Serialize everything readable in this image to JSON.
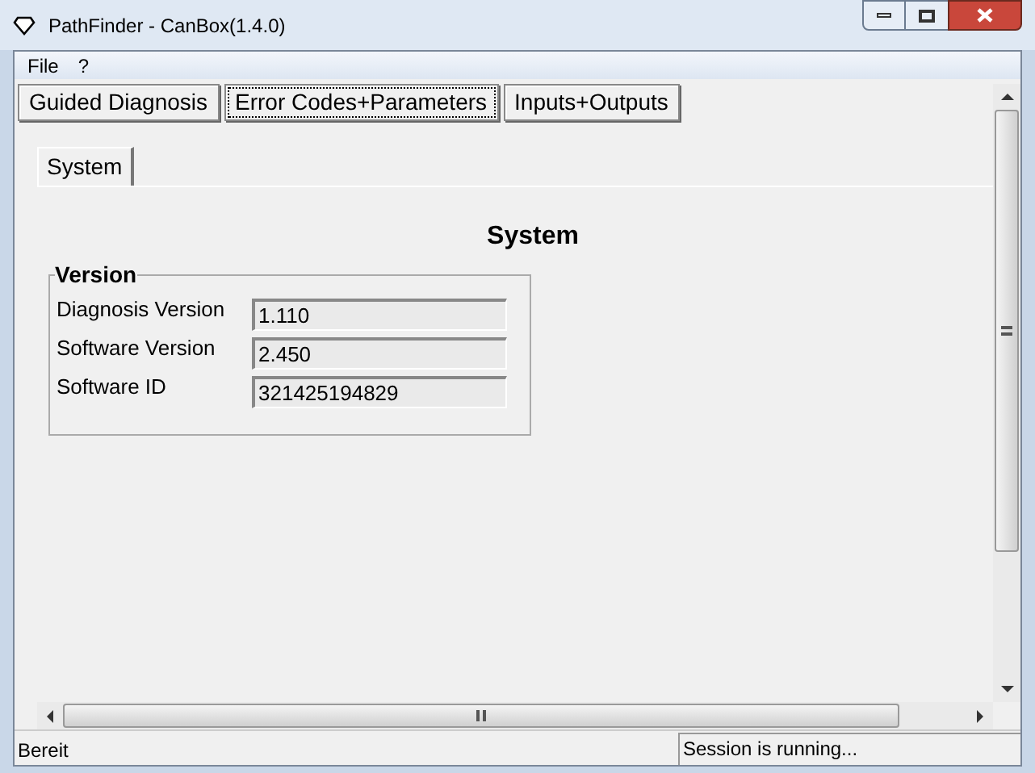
{
  "window": {
    "title": "PathFinder - CanBox(1.4.0)"
  },
  "menu": [
    "File",
    "?"
  ],
  "tabs": [
    {
      "label": "Guided Diagnosis",
      "selected": false
    },
    {
      "label": "Error Codes+Parameters",
      "selected": true
    },
    {
      "label": "Inputs+Outputs",
      "selected": false
    }
  ],
  "subtabs": [
    {
      "label": "System",
      "selected": true
    }
  ],
  "heading": "System",
  "group": {
    "title": "Version",
    "fields": [
      {
        "label": "Diagnosis Version",
        "value": "1.110"
      },
      {
        "label": "Software Version",
        "value": "2.450"
      },
      {
        "label": "Software ID",
        "value": "321425194829"
      }
    ]
  },
  "status_bar": {
    "left": "Bereit",
    "right": "Session is running..."
  }
}
